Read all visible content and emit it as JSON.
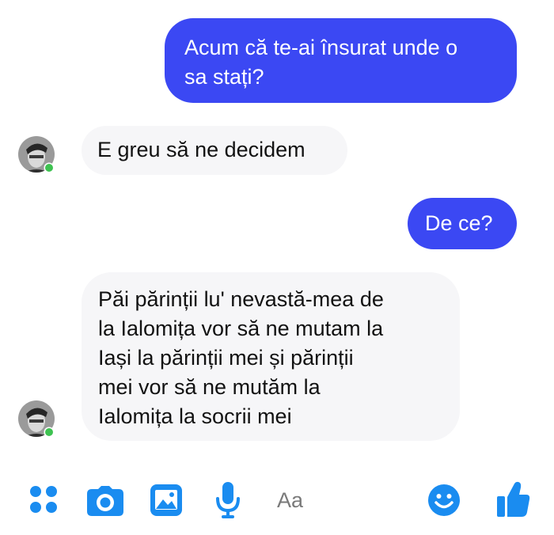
{
  "conversation": {
    "messages": [
      {
        "direction": "outgoing",
        "text": "Acum că te-ai însurat unde o sa stați?",
        "lines": [
          "Acum că te-ai însurat unde o",
          "sa stați?"
        ]
      },
      {
        "direction": "incoming",
        "text": "E greu să ne decidem",
        "lines": [
          "E greu să ne decidem"
        ]
      },
      {
        "direction": "outgoing",
        "text": "De ce?",
        "lines": [
          "De ce?"
        ]
      },
      {
        "direction": "incoming",
        "text": "Păi părinții lu' nevastă-mea de la Ialomița vor să ne mutam la Iași la părinții mei și părinții mei vor să ne mutăm la Ialomița la socrii mei",
        "lines": [
          "Păi părinții lu' nevastă-mea de",
          "la Ialomița vor să ne mutam la",
          "Iași la părinții mei și părinții",
          "mei vor să ne mutăm la",
          "Ialomița la socrii mei"
        ]
      }
    ]
  },
  "composer": {
    "placeholder": "Aa",
    "icons": [
      "more-options-icon",
      "camera-icon",
      "gallery-icon",
      "microphone-icon",
      "emoji-icon",
      "thumbs-up-icon"
    ]
  },
  "colors": {
    "outgoing_bubble": "#3b48f3",
    "incoming_bubble": "#f6f6f8",
    "accent_icon": "#1a8cf0",
    "online_dot": "#3ec251"
  }
}
